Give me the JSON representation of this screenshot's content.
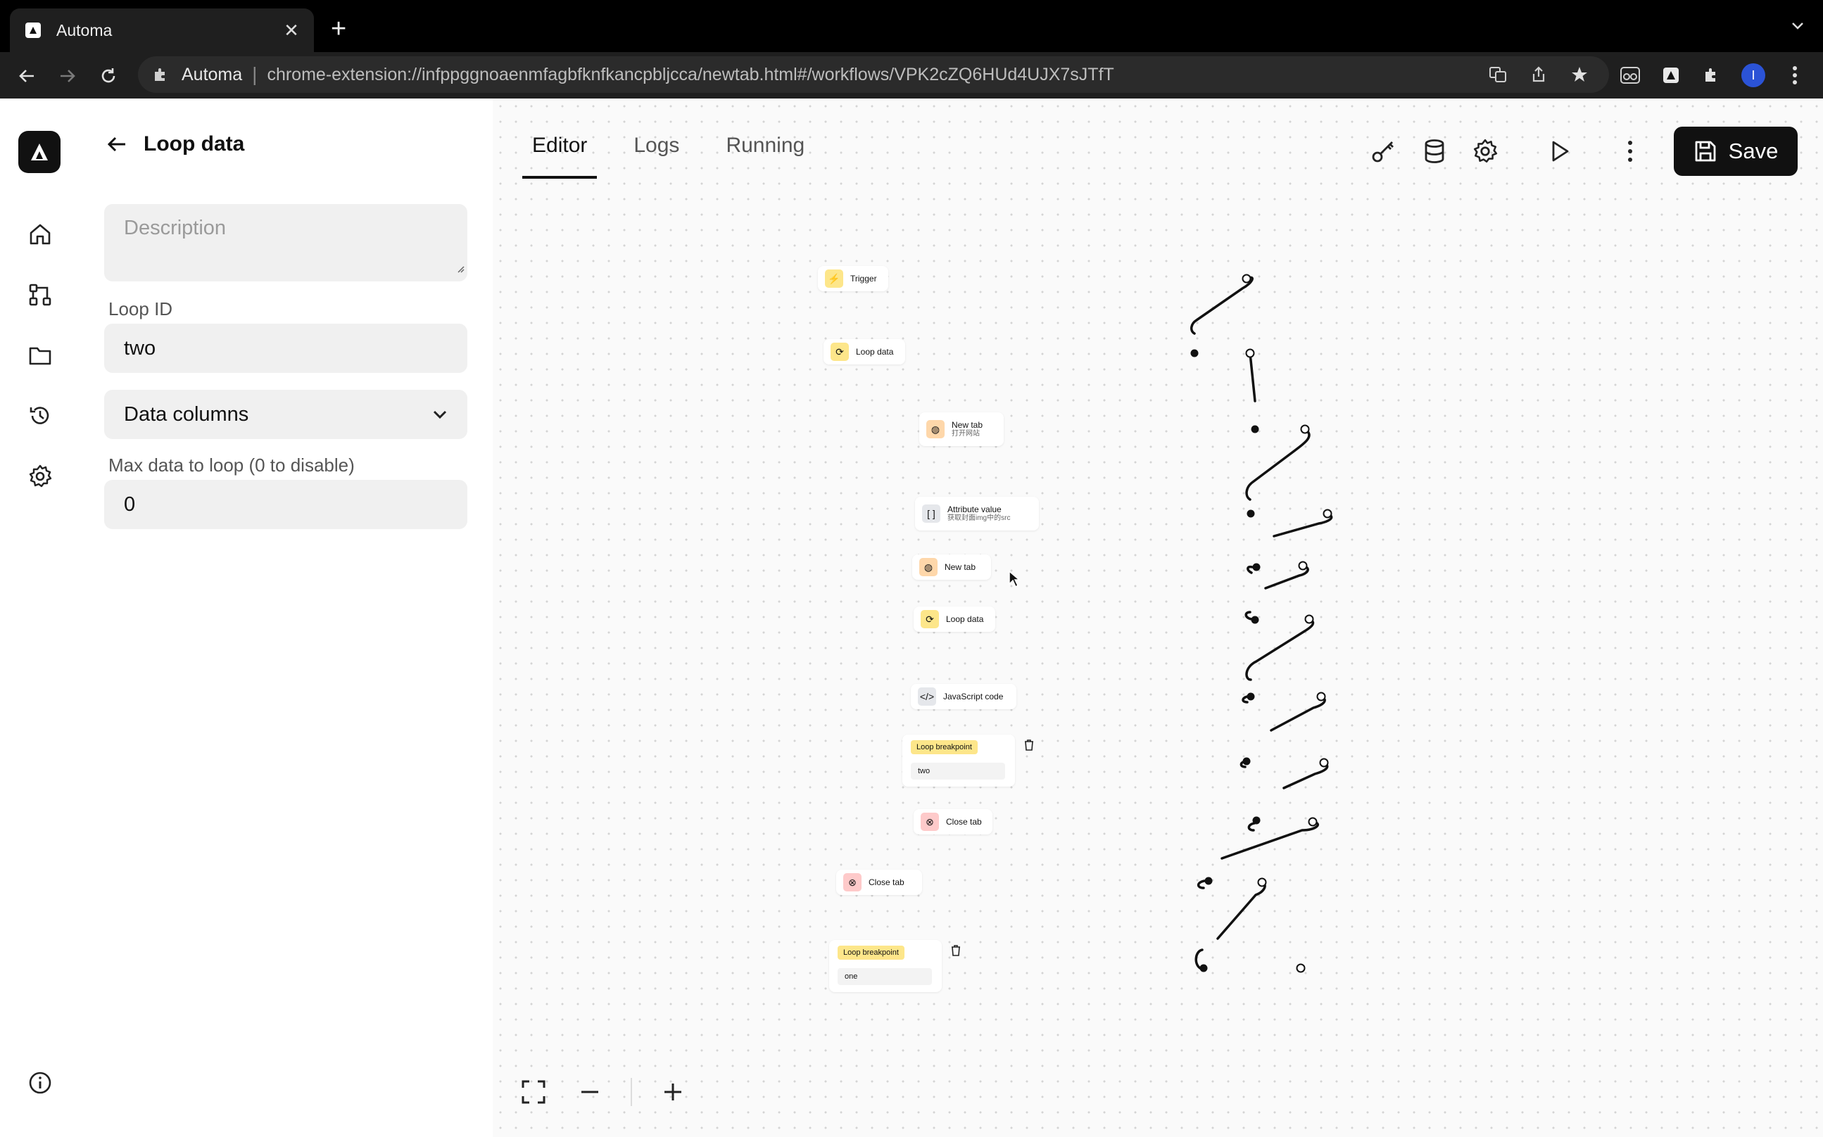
{
  "browser": {
    "tab_title": "Automa",
    "omnibox_site": "Automa",
    "url": "chrome-extension://infppggnoaenmfagbfknfkancpbljcca/newtab.html#/workflows/VPK2cZQ6HUd4UJX7sJTfT",
    "avatar_letter": "I"
  },
  "panel": {
    "title": "Loop data",
    "description_placeholder": "Description",
    "loop_id_label": "Loop ID",
    "loop_id_value": "two",
    "loop_source": "Data columns",
    "max_label": "Max data to loop (0 to disable)",
    "max_value": "0"
  },
  "tabs": [
    "Editor",
    "Logs",
    "Running"
  ],
  "toolbar": {
    "save_label": "Save"
  },
  "nodes": {
    "trigger": "Trigger",
    "loop1": "Loop data",
    "newtab1": "New tab",
    "newtab1_sub": "打开网站",
    "attr": "Attribute value",
    "attr_sub": "获取封面img中的src",
    "newtab2": "New tab",
    "loop2": "Loop data",
    "js": "JavaScript code",
    "bp1_label": "Loop breakpoint",
    "bp1_value": "two",
    "close1": "Close tab",
    "close2": "Close tab",
    "bp2_label": "Loop breakpoint",
    "bp2_value": "one"
  },
  "colors": {
    "accent_dark": "#111111",
    "node_yellow": "#fde68a",
    "node_orange": "#fed7aa",
    "node_red": "#fecaca"
  }
}
